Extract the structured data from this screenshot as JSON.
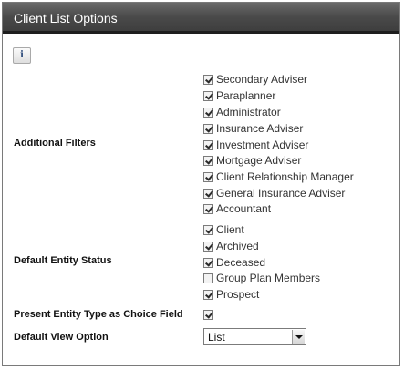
{
  "title": "Client List Options",
  "info_icon": "i",
  "additional_filters": {
    "label": "Additional Filters",
    "items": [
      {
        "label": "Secondary Adviser",
        "checked": true
      },
      {
        "label": "Paraplanner",
        "checked": true
      },
      {
        "label": "Administrator",
        "checked": true
      },
      {
        "label": "Insurance Adviser",
        "checked": true
      },
      {
        "label": "Investment Adviser",
        "checked": true
      },
      {
        "label": "Mortgage Adviser",
        "checked": true
      },
      {
        "label": "Client Relationship Manager",
        "checked": true
      },
      {
        "label": "General Insurance Adviser",
        "checked": true
      },
      {
        "label": "Accountant",
        "checked": true
      }
    ]
  },
  "default_entity_status": {
    "label": "Default Entity Status",
    "items": [
      {
        "label": "Client",
        "checked": true
      },
      {
        "label": "Archived",
        "checked": true
      },
      {
        "label": "Deceased",
        "checked": true
      },
      {
        "label": "Group Plan Members",
        "checked": false
      },
      {
        "label": "Prospect",
        "checked": true
      }
    ]
  },
  "present_entity_type": {
    "label": "Present Entity Type as Choice Field",
    "checked": true
  },
  "default_view_option": {
    "label": "Default View Option",
    "value": "List"
  }
}
